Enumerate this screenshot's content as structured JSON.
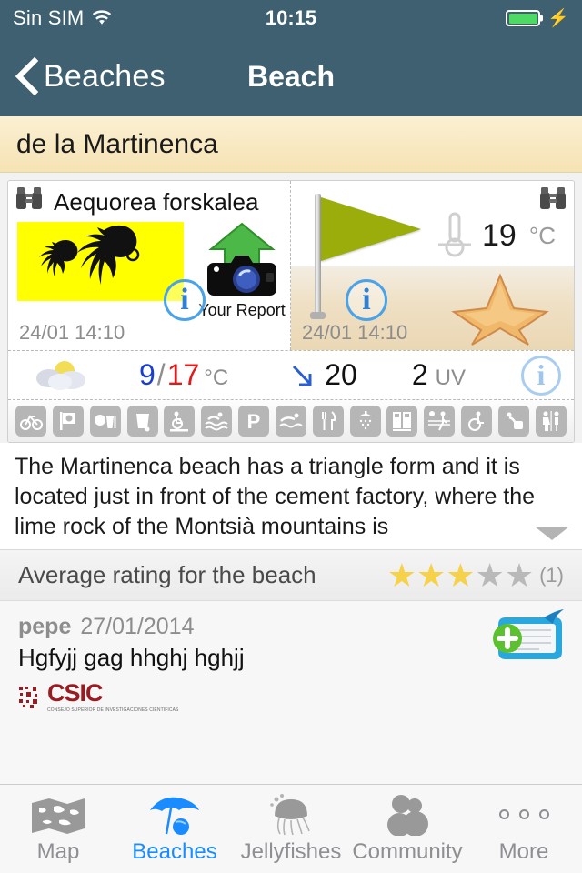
{
  "status_bar": {
    "carrier": "Sin SIM",
    "wifi_icon": "wifi-icon",
    "time": "10:15",
    "battery_icon": "battery-full-icon",
    "charging_icon": "lightning-bolt-icon"
  },
  "nav_bar": {
    "back_label": "Beaches",
    "back_icon": "chevron-left-icon",
    "title": "Beach"
  },
  "beach": {
    "name": "de la Martinenca"
  },
  "jelly_card": {
    "binoculars_icon": "binoculars-icon",
    "species": "Aequorea forskalea",
    "jellyfish_image_icon": "jellyfish-illustration",
    "info_icon": "info-icon",
    "report_icon": "camera-upload-icon",
    "report_label": "Your Report",
    "timestamp": "24/01 14:10"
  },
  "flag_card": {
    "binoculars_icon": "binoculars-icon",
    "flag_icon": "green-flag-icon",
    "flag_color": "#9aad0a",
    "thermometer_icon": "thermometer-icon",
    "water_temp": "19",
    "water_temp_unit": "°C",
    "info_icon": "info-icon",
    "starfish_icon": "starfish-icon",
    "timestamp": "24/01 14:10"
  },
  "weather": {
    "condition_icon": "sun-behind-clouds-icon",
    "temp_min": "9",
    "temp_separator": "/",
    "temp_max": "17",
    "temp_unit": "°C",
    "wind_icon": "wind-direction-arrow-icon",
    "wind_speed": "20",
    "uv_value": "2",
    "uv_label": "UV",
    "info_icon": "info-icon",
    "min_color": "#1a3fd0",
    "max_color": "#e01b1b"
  },
  "services": [
    {
      "icon": "bicycle-parking-icon"
    },
    {
      "icon": "beach-flag-icon"
    },
    {
      "icon": "beach-toys-icon"
    },
    {
      "icon": "waste-bin-icon"
    },
    {
      "icon": "accessible-walkway-icon"
    },
    {
      "icon": "accessible-bathing-icon"
    },
    {
      "icon": "parking-icon"
    },
    {
      "icon": "swimming-icon"
    },
    {
      "icon": "restaurant-icon"
    },
    {
      "icon": "shower-icon"
    },
    {
      "icon": "lockers-icon"
    },
    {
      "icon": "volleyball-icon"
    },
    {
      "icon": "accessible-chair-icon"
    },
    {
      "icon": "drinking-fountain-icon"
    },
    {
      "icon": "toilets-icon"
    }
  ],
  "description": {
    "text": "The Martinenca beach has a triangle form and it is located just in front of the cement factory, where the lime rock of the Montsià mountains is",
    "toggle_icon": "chevron-down-icon"
  },
  "rating": {
    "label": "Average rating for the beach",
    "filled": 3,
    "total": 5,
    "count": "(1)",
    "star_on_color": "#f5d24a",
    "star_off_color": "#b9b9b9"
  },
  "comments": {
    "add_icon": "add-comment-icon",
    "items": [
      {
        "user": "pepe",
        "date": "27/01/2014",
        "text": "Hgfyjj gag hhghj hghjj"
      }
    ],
    "logo": {
      "name": "CSIC",
      "subtitle": "CONSEJO SUPERIOR DE INVESTIGACIONES CIENTÍFICAS",
      "color": "#9b1b22"
    }
  },
  "tab_bar": {
    "active_color": "#1a8cff",
    "inactive_color": "#8e8e93",
    "tabs": [
      {
        "label": "Map",
        "icon": "map-icon",
        "active": false
      },
      {
        "label": "Beaches",
        "icon": "umbrella-icon",
        "active": true
      },
      {
        "label": "Jellyfishes",
        "icon": "jellyfish-icon",
        "active": false
      },
      {
        "label": "Community",
        "icon": "people-icon",
        "active": false
      },
      {
        "label": "More",
        "icon": "more-dots-icon",
        "active": false
      }
    ]
  }
}
